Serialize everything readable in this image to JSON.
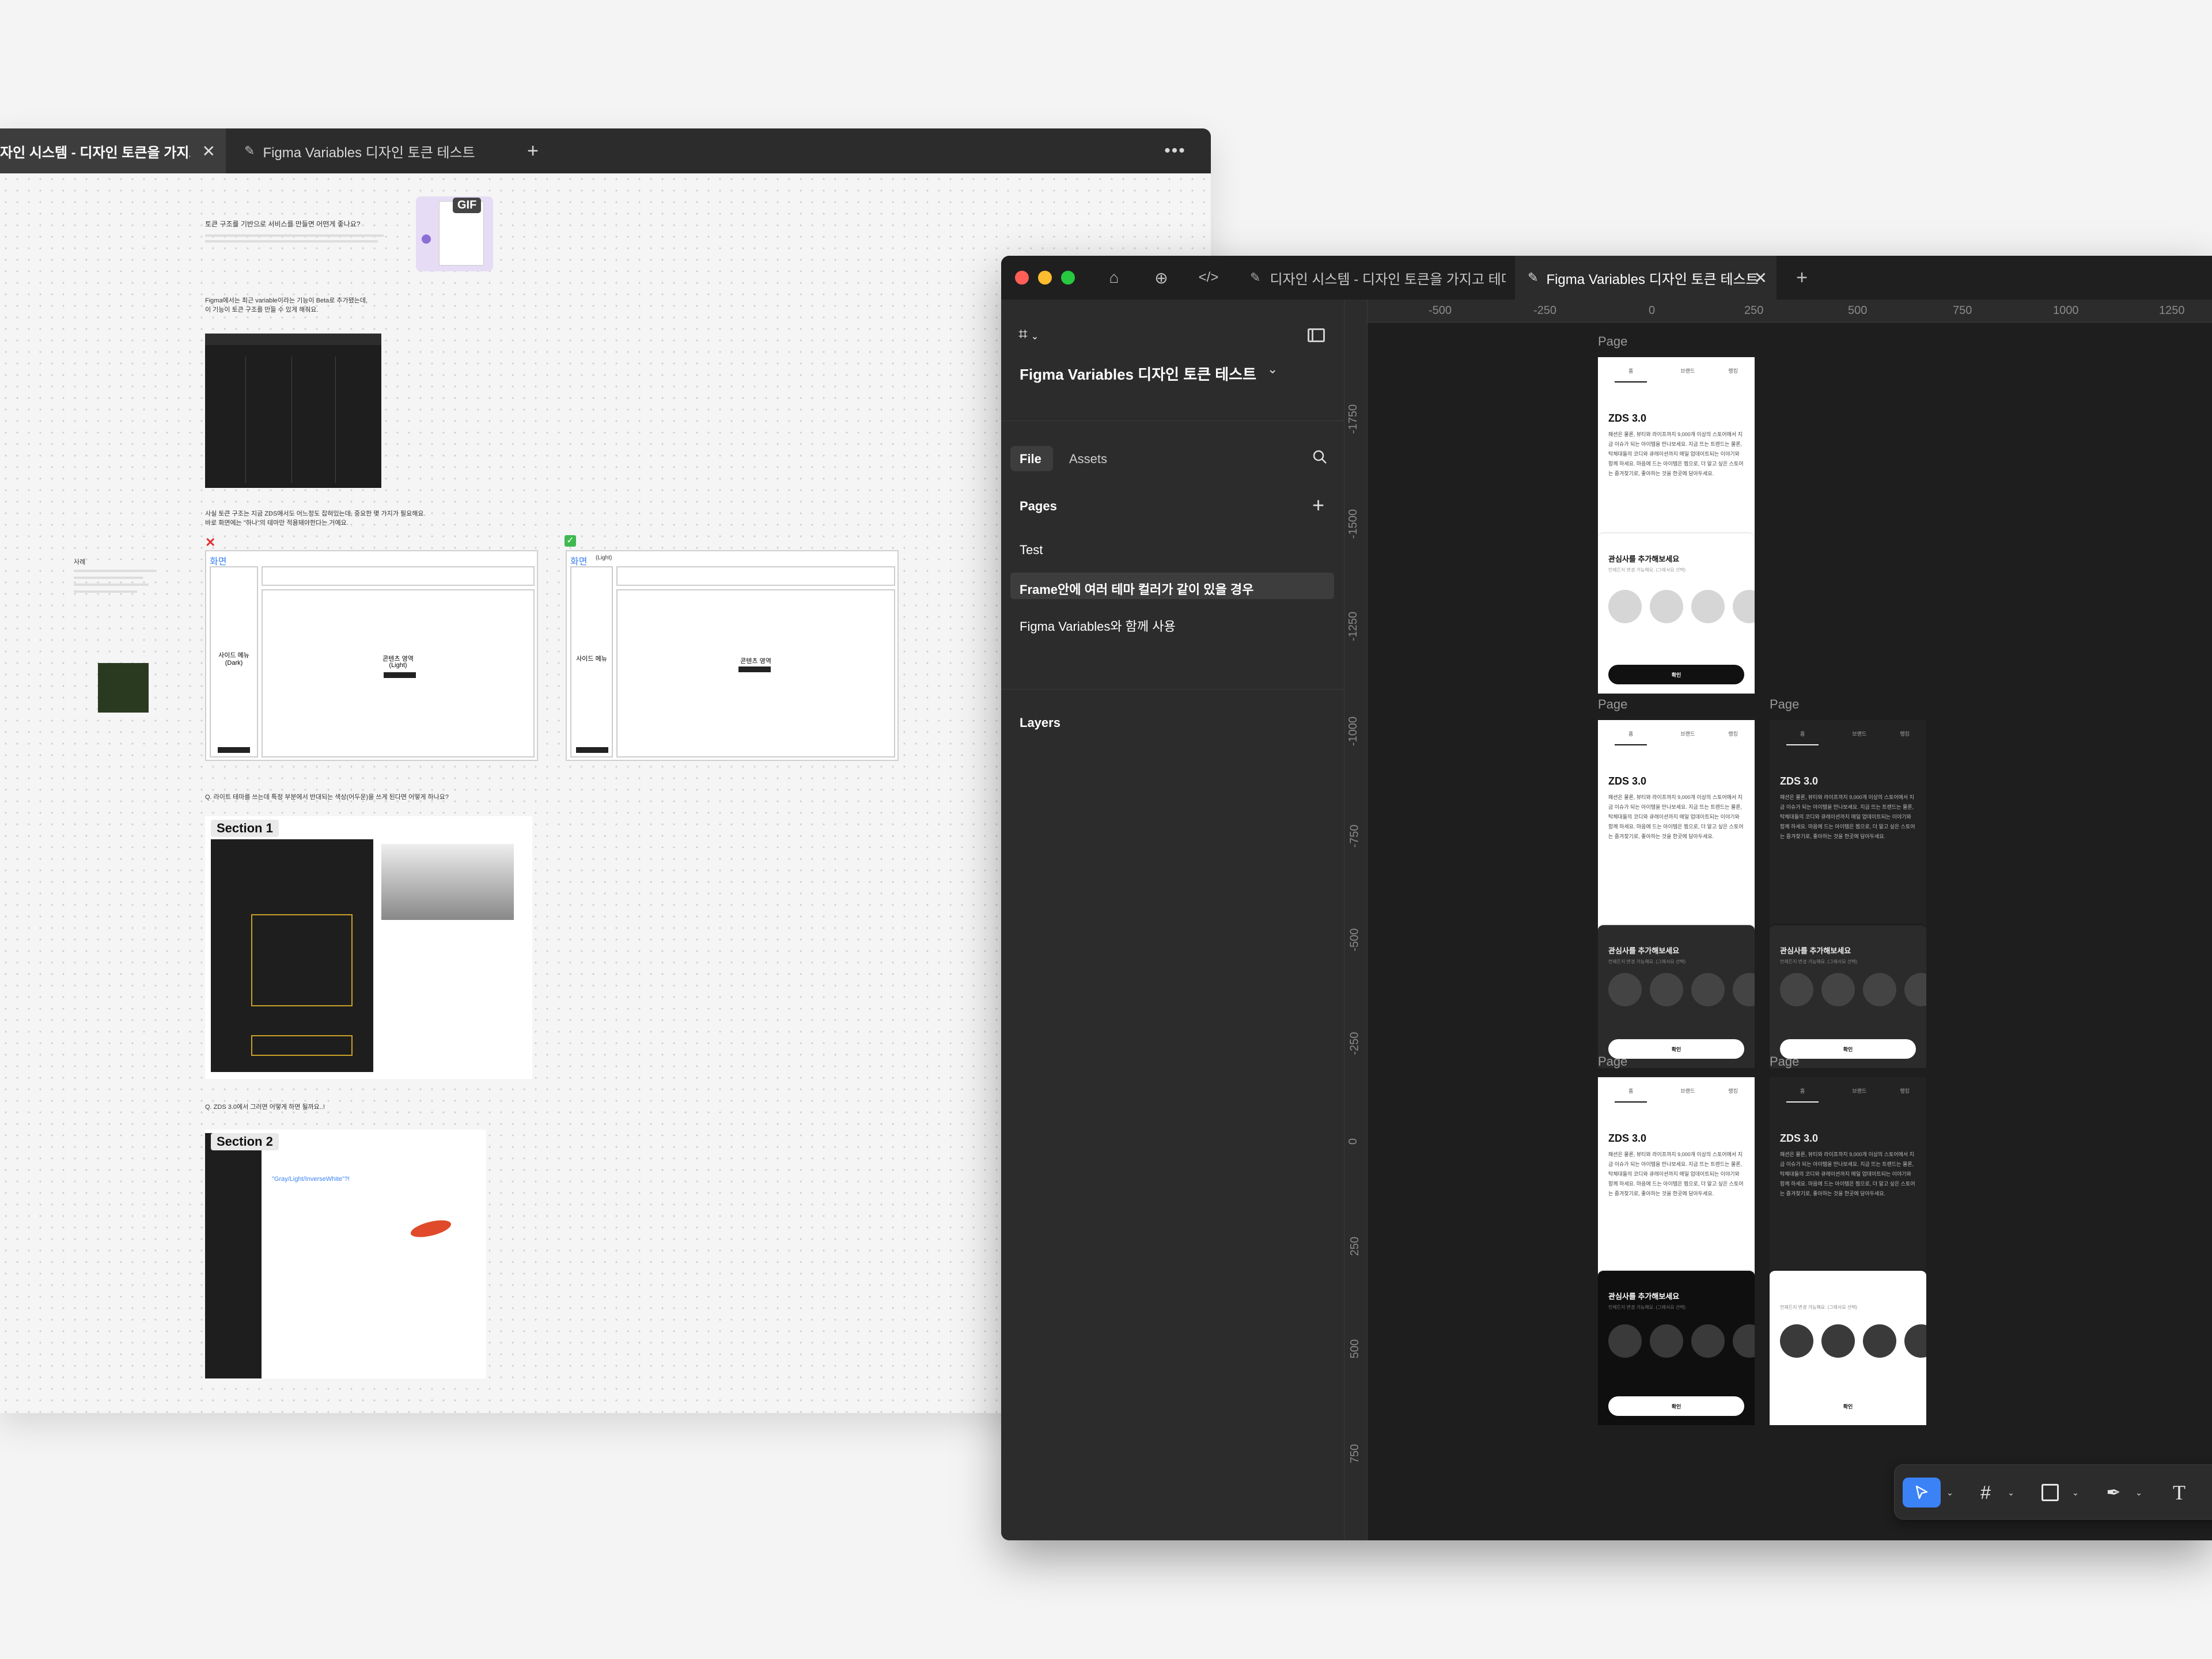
{
  "back_window": {
    "tabs": [
      {
        "title": "자인 시스템 - 디자인 토큰을 가지고 테",
        "active": true
      },
      {
        "title": "Figma Variables 디자인 토큰 테스트",
        "active": false
      }
    ],
    "board": {
      "q1": "토큰 구조를 기반으로 서비스를 만들면 어떤게 좋나요?",
      "gif_label": "GIF",
      "intro_line1": "Figma에서는 최근 variable이라는 기능이 Beta로 추가됐는데,",
      "intro_line2": "이 기능이 토큰 구조를 만들 수 있게 해줘요.",
      "para_line1": "사실 토큰 구조는 지금 ZDS에서도 어느정도 잡혀있는데, 중요한 몇 가지가 필요해요.",
      "para_line2": "바로 화면에는 \"하나\"의 테마만 적용돼야한다는 거예요.",
      "side_label": "사례",
      "wrong_mark": "✕",
      "right_mark": "✓",
      "screen_left": "화면",
      "screen_right": "화면",
      "screen_right_note": "(Light)",
      "side_menu_dark": "사이드 메뉴",
      "side_menu_dark_note": "(Dark)",
      "content_area": "콘텐츠 영역",
      "content_area_note": "(Light)",
      "side_menu": "사이드 메뉴",
      "content_area_2": "콘텐츠 영역",
      "q2": "Q. 라이트 테마를 쓰는데 특정 부분에서 반대되는 색상(어두운)을 쓰게 된다면 어떻게 하나요?",
      "section1": "Section 1",
      "q3": "Q. ZDS 3.0에서 그러면 어떻게 하면 될까요..!",
      "section2": "Section 2",
      "token_name": "\"Gray/Light/InverseWhite\"?!"
    }
  },
  "front_window": {
    "tabs": [
      {
        "title": "디자인 시스템 - 디자인 토큰을 가지고 테마를",
        "active": false
      },
      {
        "title": "Figma Variables 디자인 토큰 테스트",
        "active": true
      }
    ],
    "panel": {
      "file_name": "Figma Variables 디자인 토큰 테스트",
      "tab_file": "File",
      "tab_assets": "Assets",
      "pages_title": "Pages",
      "pages": [
        {
          "name": "Test",
          "selected": false
        },
        {
          "name": "Frame안에 여러 테마 컬러가 같이 있을 경우",
          "selected": true
        },
        {
          "name": "Figma Variables와 함께 사용",
          "selected": false
        }
      ],
      "layers_title": "Layers"
    },
    "ruler_x": [
      "-500",
      "-250",
      "0",
      "250",
      "500",
      "750",
      "1000",
      "1250"
    ],
    "ruler_y": [
      "-1750",
      "-1500",
      "-1250",
      "-1000",
      "-750",
      "-500",
      "-250",
      "0",
      "250",
      "500",
      "750"
    ],
    "page_label": "Page",
    "frame": {
      "tabs": [
        "홈",
        "브랜드",
        "랭킹"
      ],
      "title": "ZDS 3.0",
      "body": "패션은 물론, 뷰티와 라이프까지 9,000개 이상의 스토어에서 지금 이슈가 되는 아이템을 만나보세요. 지금 뜨는 트렌드는 물론, 탁체대들의 코디와 큐레이션까지 매일 업데이트되는 이야기와 함께 하세요. 마음에 드는 아이템은 찜으로, 더 알고 싶은 스토어는 즐겨찾기로, 좋아하는 것을 한곳에 담아두세요.",
      "interest_title": "관심사를 추가해보세요",
      "interest_sub": "언제든지 변경 가능해요. (그래서요 선택)",
      "confirm": "확인"
    }
  }
}
